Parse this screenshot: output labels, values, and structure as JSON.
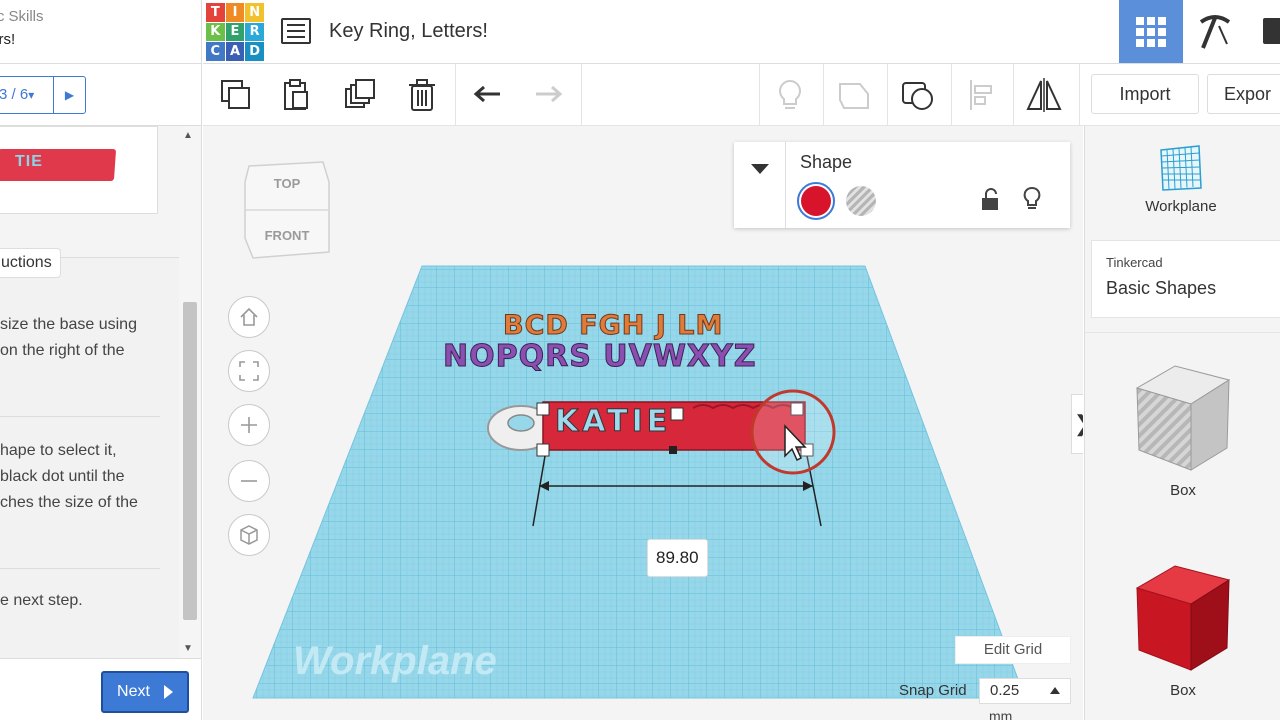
{
  "lesson": {
    "header_line1": "sic Skills",
    "header_line2": "ters!",
    "step_indicator": "3 / 6",
    "thumbnail_text": "TIE",
    "instructions_tab": "uctions",
    "paragraph1": [
      "size the base using",
      "on the right of the"
    ],
    "paragraph2": [
      "hape to select it,",
      "black dot until the",
      "ches the size of the"
    ],
    "paragraph3": "e next step.",
    "next_label": "Next"
  },
  "logo": {
    "letters": [
      "T",
      "I",
      "N",
      "K",
      "E",
      "R",
      "C",
      "A",
      "D"
    ],
    "colors": [
      "#e4433c",
      "#f08a24",
      "#f2c12e",
      "#6cc04a",
      "#2fa36b",
      "#2aa8d8",
      "#4179c7",
      "#3a5fb5",
      "#1a8fc4"
    ]
  },
  "project": {
    "title": "Key Ring, Letters!"
  },
  "toolbar": {
    "import_label": "Import",
    "export_label": "Expor"
  },
  "viewcube": {
    "top_label": "TOP",
    "front_label": "FRONT"
  },
  "inspector": {
    "title": "Shape",
    "solid_color": "#d7142b"
  },
  "workplane": {
    "watermark": "Workplane",
    "letters_row1": "BCD FGH J LM",
    "letters_row2": "NOPQRS UVWXYZ",
    "selected_text": "KATIE",
    "dimension": "89.80"
  },
  "grid_controls": {
    "edit_grid_label": "Edit Grid",
    "snap_label": "Snap Grid",
    "snap_value": "0.25",
    "snap_unit": "mm"
  },
  "shapes_panel": {
    "workplane_label": "Workplane",
    "library_source": "Tinkercad",
    "library_name": "Basic Shapes",
    "items": [
      {
        "label": "Box"
      },
      {
        "label": "Box"
      }
    ]
  },
  "colors": {
    "accent": "#3d7ad6",
    "grid_blue": "#8fd3e8",
    "shape_red": "#d7142b"
  }
}
